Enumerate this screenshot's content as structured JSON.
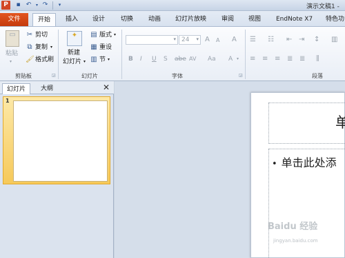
{
  "titlebar": {
    "app_badge": "P",
    "window_title": "演示文稿1 -",
    "qat": {
      "save_icon": "save-icon",
      "undo_icon": "undo-icon",
      "redo_icon": "redo-icon",
      "customize_icon": "chevron-down-icon"
    }
  },
  "tabs": {
    "file": "文件",
    "items": [
      "开始",
      "插入",
      "设计",
      "切换",
      "动画",
      "幻灯片放映",
      "审阅",
      "视图",
      "EndNote X7",
      "特色功"
    ],
    "active_index": 0
  },
  "ribbon": {
    "clipboard": {
      "paste": "粘贴",
      "cut": "剪切",
      "copy": "复制",
      "format_painter": "格式刷",
      "label": "剪贴板"
    },
    "slides": {
      "new_slide_line1": "新建",
      "new_slide_line2": "幻灯片",
      "layout": "版式",
      "reset": "重设",
      "section": "节",
      "label": "幻灯片"
    },
    "font": {
      "font_name": "",
      "font_size": "24",
      "grow": "A",
      "shrink": "A",
      "clear": "A",
      "bold": "B",
      "italic": "I",
      "underline": "U",
      "shadow": "S",
      "strike": "abe",
      "spacing": "AV",
      "case": "Aa",
      "color": "A",
      "label": "字体"
    },
    "paragraph": {
      "label": "段落"
    }
  },
  "left_pane": {
    "tab_slides": "幻灯片",
    "tab_outline": "大纲",
    "close": "✕",
    "thumbnails": [
      {
        "number": "1"
      }
    ]
  },
  "slide": {
    "title_placeholder": "单",
    "bullet": "•",
    "body_placeholder": "单击此处添"
  },
  "watermark": {
    "main": "Baidu 经验",
    "sub": "jingyan.baidu.com"
  },
  "colors": {
    "file_tab": "#d24726",
    "selected_thumb": "#f6c95a",
    "ribbon_bg": "#fbfcfe"
  }
}
